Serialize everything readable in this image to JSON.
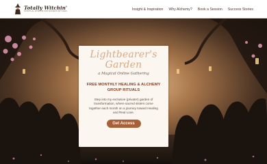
{
  "header": {
    "brand_name": "Totally Witchin'",
    "brand_tagline": "Spiritual Wisdom for Modern Witches",
    "nav": [
      {
        "label": "Insight & Inspiration"
      },
      {
        "label": "Why Alchemy?"
      },
      {
        "label": "Book a Session"
      },
      {
        "label": "Success Stories"
      }
    ]
  },
  "hero": {
    "title": "Lightbearer's Garden",
    "subtitle": "a Magical Online Gathering",
    "heading": "FREE MONTHLY HEALING & ALCHEMY GROUP RITUALS",
    "body": "Step into my exclusive (private!) garden of transformation, where sacred sisters come together each month on a journey toward Healing and Real Love.",
    "cta_label": "Get Access"
  },
  "colors": {
    "accent": "#a8603a",
    "title_color": "#d8a985",
    "heading_color": "#8a3b1e"
  }
}
